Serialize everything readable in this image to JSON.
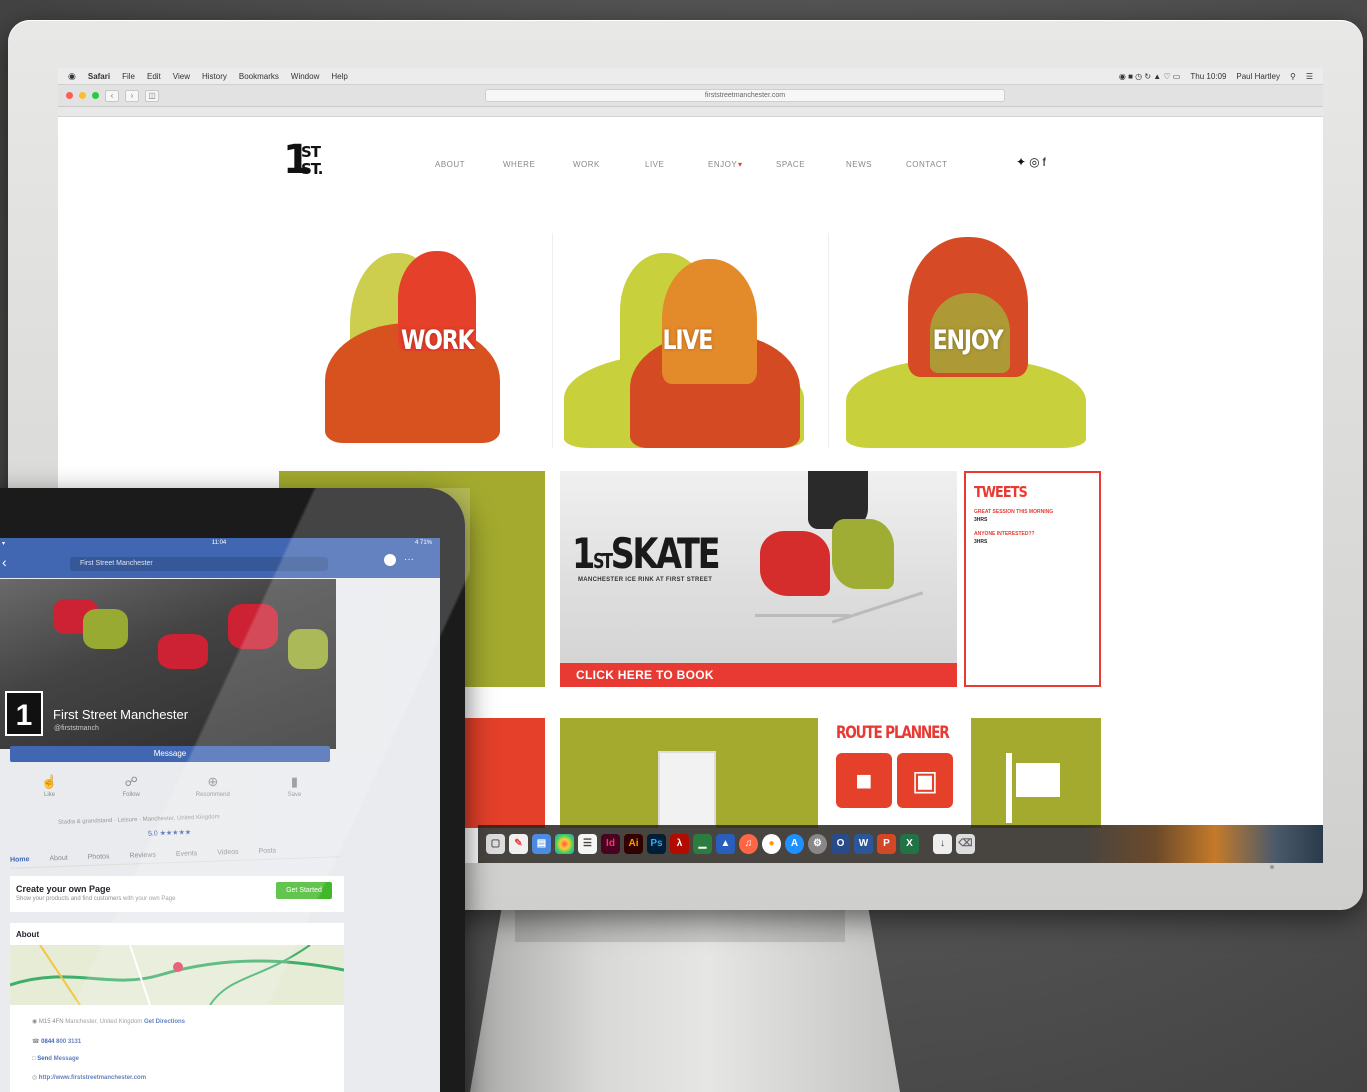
{
  "menubar": {
    "apple": "",
    "app": "Safari",
    "items": [
      "File",
      "Edit",
      "View",
      "History",
      "Bookmarks",
      "Window",
      "Help"
    ],
    "clock": "Thu 10:09",
    "user": "Paul Hartley"
  },
  "browser": {
    "url": "firststreetmanchester.com"
  },
  "site": {
    "nav": [
      "ABOUT",
      "WHERE",
      "WORK",
      "LIVE",
      "ENJOY",
      "SPACE",
      "NEWS",
      "CONTACT"
    ],
    "social": "✦◎f",
    "hero": [
      {
        "word": "WORK"
      },
      {
        "word": "LIVE"
      },
      {
        "word": "ENJOY"
      }
    ],
    "skate": {
      "title": "SKATE",
      "subtitle": "MANCHESTER ICE RINK AT FIRST STREET",
      "book": "CLICK HERE TO BOOK"
    },
    "tweets": {
      "title": "TWEETS",
      "items": [
        {
          "text": "GREAT SESSION THIS MORNING",
          "time": "3HRS"
        },
        {
          "text": "ANYONE INTERESTED??",
          "time": "3HRS"
        }
      ]
    },
    "route": {
      "title": "ROUTE PLANNER"
    }
  },
  "colors": {
    "olive": "#a3aa2e",
    "red": "#e4402a",
    "accent": "#e83a33"
  },
  "facebook": {
    "status_time": "11:04",
    "status_battery": "4 71%",
    "search": "First Street Manchester",
    "page_name": "First Street Manchester",
    "handle": "@firststmanch",
    "message": "Message",
    "actions": [
      "Like",
      "Follow",
      "Recommend",
      "Save"
    ],
    "info": "Stadia & grandstand · Leisure · Manchester, United Kingdom",
    "rating": "5.0 ★★★★★",
    "tabs": [
      "Home",
      "About",
      "Photos",
      "Reviews",
      "Events",
      "Videos",
      "Posts"
    ],
    "create_title": "Create your own Page",
    "create_sub": "Show your products and find customers with your own Page",
    "create_btn": "Get Started",
    "about_title": "About",
    "address": "M15 4FN Manchester, United Kingdom",
    "directions": "Get Directions",
    "phone": "0844 800 3131",
    "send_message": "Send Message",
    "website": "http://www.firststreetmanchester.com"
  }
}
